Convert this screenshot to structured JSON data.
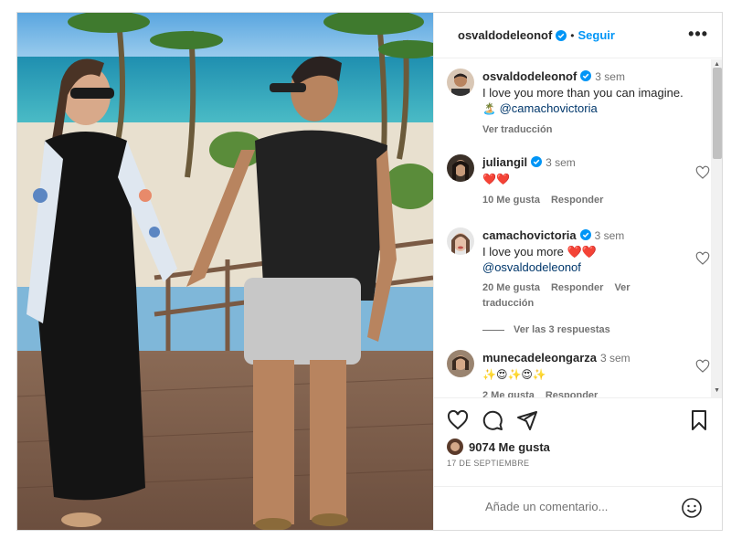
{
  "post": {
    "author": "osvaldodeleonof",
    "follow_label": "Seguir",
    "more_label": "•••",
    "caption": {
      "user": "osvaldodeleonof",
      "time": "3 sem",
      "text": "I love you more than you can imagine.",
      "emoji": "🏝️",
      "mention": "@camachovictoria",
      "translate": "Ver traducción"
    },
    "comments": [
      {
        "user": "juliangil",
        "time": "3 sem",
        "text": "❤️❤️",
        "likes": "10 Me gusta",
        "reply": "Responder"
      },
      {
        "user": "camachovictoria",
        "time": "3 sem",
        "text": "I love you more ❤️❤️",
        "mention": "@osvaldodeleonof",
        "likes": "20 Me gusta",
        "reply": "Responder",
        "translate": "Ver traducción"
      },
      {
        "user": "munecadeleongarza",
        "time": "3 sem",
        "text": "✨😍✨😍✨",
        "likes": "2 Me gusta",
        "reply": "Responder"
      }
    ],
    "view_replies": "Ver las 3 respuestas",
    "like_count": "9074 Me gusta",
    "date": "17 DE SEPTIEMBRE",
    "comment_placeholder": "Añade un comentario..."
  },
  "colors": {
    "accent": "#0095f6",
    "verified": "#0095f6",
    "heart": "#ed4956",
    "muted": "#737373"
  }
}
